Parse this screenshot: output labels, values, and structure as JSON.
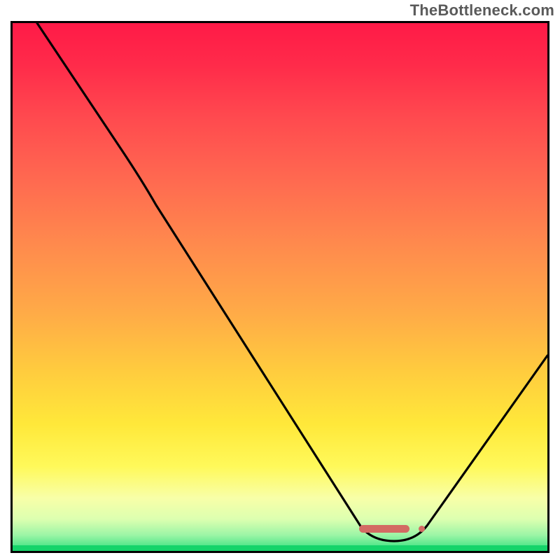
{
  "watermark": "TheBottleneck.com",
  "chart_data": {
    "type": "line",
    "title": "",
    "xlabel": "",
    "ylabel": "",
    "xlim": [
      0,
      100
    ],
    "ylim": [
      0,
      100
    ],
    "grid": false,
    "series": [
      {
        "name": "bottleneck-curve",
        "x": [
          5,
          20,
          27,
          65,
          72,
          78,
          100
        ],
        "y": [
          100,
          76,
          66,
          5,
          2,
          5,
          37
        ]
      }
    ],
    "annotations": [
      {
        "type": "pill",
        "x_start": 65,
        "x_end": 74,
        "y": 3,
        "color": "#d36b63"
      },
      {
        "type": "dot",
        "x": 76,
        "y": 3,
        "color": "#d36b63"
      }
    ],
    "background": {
      "type": "vertical-gradient",
      "stops": [
        {
          "pos": 0.0,
          "color": "#ff1a47"
        },
        {
          "pos": 0.3,
          "color": "#ff6a50"
        },
        {
          "pos": 0.66,
          "color": "#ffcc3e"
        },
        {
          "pos": 0.9,
          "color": "#f8ffa8"
        },
        {
          "pos": 1.0,
          "color": "#15d46a"
        }
      ]
    }
  }
}
